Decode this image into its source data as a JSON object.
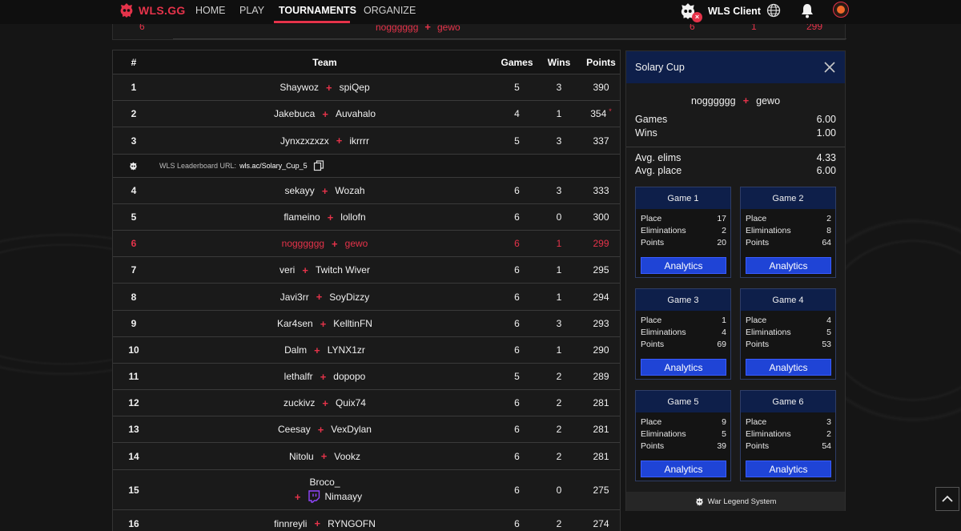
{
  "nav": {
    "brand": "WLS.GG",
    "links": [
      "HOME",
      "PLAY",
      "TOURNAMENTS",
      "ORGANIZE"
    ],
    "active": "TOURNAMENTS",
    "client_label": "WLS Client"
  },
  "strip_row": {
    "rank": "6",
    "player1": "nogggggg",
    "player2": "gewo",
    "games": "6",
    "wins": "1",
    "points": "299"
  },
  "table": {
    "headers": {
      "rank": "#",
      "team": "Team",
      "games": "Games",
      "wins": "Wins",
      "points": "Points"
    },
    "url_label": "WLS Leaderboard URL:",
    "url_value": "wls.ac/Solary_Cup_5",
    "rows": [
      {
        "rank": "1",
        "p1": "Shaywoz",
        "p2": "spiQep",
        "games": "5",
        "wins": "3",
        "points": "390"
      },
      {
        "rank": "2",
        "p1": "Jakebuca",
        "p2": "Auvahalo",
        "games": "4",
        "wins": "1",
        "points": "354",
        "star": "*"
      },
      {
        "rank": "3",
        "p1": "Jynxzxzxzx",
        "p2": "ikrrrr",
        "games": "5",
        "wins": "3",
        "points": "337"
      },
      {
        "rank": "4",
        "p1": "sekayy",
        "p2": "Wozah",
        "games": "6",
        "wins": "3",
        "points": "333"
      },
      {
        "rank": "5",
        "p1": "flameino",
        "p2": "lollofn",
        "games": "6",
        "wins": "0",
        "points": "300"
      },
      {
        "rank": "6",
        "p1": "nogggggg",
        "p2": "gewo",
        "games": "6",
        "wins": "1",
        "points": "299"
      },
      {
        "rank": "7",
        "p1": "veri",
        "p2": "Twitch Wiver",
        "games": "6",
        "wins": "1",
        "points": "295"
      },
      {
        "rank": "8",
        "p1": "Javi3rr",
        "p2": "SoyDizzy",
        "games": "6",
        "wins": "1",
        "points": "294"
      },
      {
        "rank": "9",
        "p1": "Kar4sen",
        "p2": "KelltinFN",
        "games": "6",
        "wins": "3",
        "points": "293"
      },
      {
        "rank": "10",
        "p1": "Dalm",
        "p2": "LYNX1zr",
        "games": "6",
        "wins": "1",
        "points": "290"
      },
      {
        "rank": "11",
        "p1": "lethalfr",
        "p2": "dopopo",
        "games": "5",
        "wins": "2",
        "points": "289"
      },
      {
        "rank": "12",
        "p1": "zuckivz",
        "p2": "Quix74",
        "games": "6",
        "wins": "2",
        "points": "281"
      },
      {
        "rank": "13",
        "p1": "Ceesay",
        "p2": "VexDylan",
        "games": "6",
        "wins": "2",
        "points": "281"
      },
      {
        "rank": "14",
        "p1": "Nitolu",
        "p2": "Vookz",
        "games": "6",
        "wins": "2",
        "points": "281"
      },
      {
        "rank": "15",
        "p1": "Broco_",
        "p2": "Nimaayy",
        "games": "6",
        "wins": "0",
        "points": "275"
      },
      {
        "rank": "16",
        "p1": "finnreyli",
        "p2": "RYNGOFN",
        "games": "6",
        "wins": "2",
        "points": "274"
      }
    ]
  },
  "panel": {
    "title": "Solary Cup",
    "player1": "nogggggg",
    "player2": "gewo",
    "stats": {
      "games_label": "Games",
      "games": "6.00",
      "wins_label": "Wins",
      "wins": "1.00",
      "elims_label": "Avg. elims",
      "elims": "4.33",
      "place_label": "Avg. place",
      "place": "6.00"
    },
    "labels": {
      "place": "Place",
      "elims": "Eliminations",
      "points": "Points",
      "button": "Analytics"
    },
    "games": [
      {
        "title": "Game 1",
        "place": "17",
        "elims": "2",
        "points": "20"
      },
      {
        "title": "Game 2",
        "place": "2",
        "elims": "8",
        "points": "64"
      },
      {
        "title": "Game 3",
        "place": "1",
        "elims": "4",
        "points": "69"
      },
      {
        "title": "Game 4",
        "place": "4",
        "elims": "5",
        "points": "53"
      },
      {
        "title": "Game 5",
        "place": "9",
        "elims": "5",
        "points": "39"
      },
      {
        "title": "Game 6",
        "place": "3",
        "elims": "2",
        "points": "54"
      }
    ],
    "footer": "War Legend System"
  },
  "colors": {
    "accent": "#e5334a",
    "panel_blue": "#0e1f4a",
    "button_blue": "#1f44d6"
  }
}
